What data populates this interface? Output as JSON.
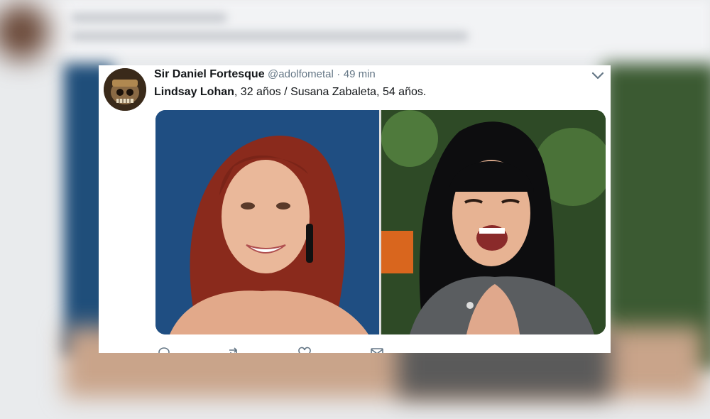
{
  "tweet": {
    "author_name": "Sir Daniel Fortesque",
    "author_handle": "@adolfometal",
    "separator": "·",
    "timestamp": "49 min",
    "text_bold": "Lindsay Lohan",
    "text_rest": ", 32 años / Susana Zabaleta, 54 años.",
    "images": [
      {
        "subject": "red-haired woman smiling on blue background"
      },
      {
        "subject": "black-haired woman laughing in grey dress outdoors"
      }
    ],
    "actions": [
      "reply-icon",
      "retweet-icon",
      "like-icon",
      "message-icon"
    ]
  },
  "colors": {
    "name": "#14171a",
    "muted": "#657786",
    "card_bg": "#ffffff"
  }
}
